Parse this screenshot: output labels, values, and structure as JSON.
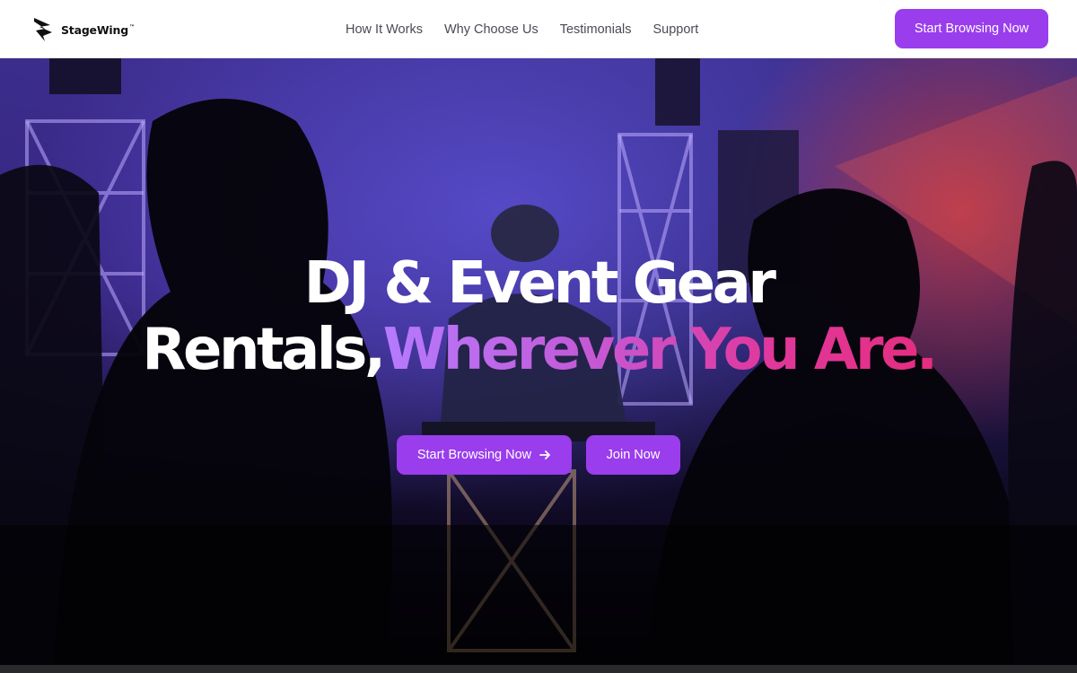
{
  "brand": {
    "name": "StageWing",
    "tm": "™",
    "logo_icon": "stagewing-logo-icon"
  },
  "nav": {
    "links": [
      "How It Works",
      "Why Choose Us",
      "Testimonials",
      "Support"
    ],
    "cta_label": "Start Browsing Now"
  },
  "hero": {
    "title_line1": "DJ & Event Gear",
    "title_line2_plain": "Rentals,",
    "title_line2_highlight": "Wherever You Are.",
    "primary_button": "Start Browsing Now",
    "secondary_button": "Join Now",
    "arrow_icon": "arrow-right-icon"
  },
  "colors": {
    "accent": "#9a3ded",
    "gradient_start": "#b57bff",
    "gradient_end": "#e42d7f",
    "nav_text": "#4a4a55"
  }
}
